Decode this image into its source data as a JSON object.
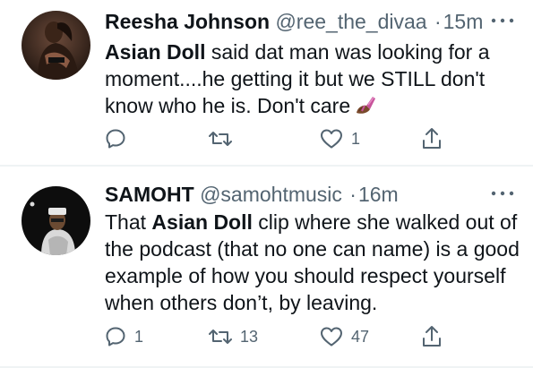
{
  "colors": {
    "text_primary": "#0f1419",
    "text_secondary": "#536471",
    "divider": "#eff3f4",
    "background": "#ffffff"
  },
  "tweets": [
    {
      "name": "Reesha Johnson",
      "handle": "@ree_the_divaa",
      "separator": "·",
      "time": "15m",
      "text_parts": [
        {
          "text": "Asian Doll",
          "bold": true
        },
        {
          "text": " said dat man was looking for a moment....he getting it but we STILL don't know who he is. Don't care",
          "bold": false
        }
      ],
      "emoji": "nail-polish-icon",
      "actions": {
        "reply_count": "",
        "retweet_count": "",
        "like_count": "1"
      },
      "avatar_icon": "profile-photo-icon"
    },
    {
      "name": "SAMOHT",
      "handle": "@samohtmusic",
      "separator": "·",
      "time": "16m",
      "text_parts": [
        {
          "text": "That ",
          "bold": false
        },
        {
          "text": "Asian Doll",
          "bold": true
        },
        {
          "text": " clip where she walked out of the podcast (that no one can name) is a good example of how you should respect yourself when others don’t, by leaving.",
          "bold": false
        }
      ],
      "actions": {
        "reply_count": "1",
        "retweet_count": "13",
        "like_count": "47"
      },
      "avatar_icon": "profile-photo-icon"
    }
  ]
}
